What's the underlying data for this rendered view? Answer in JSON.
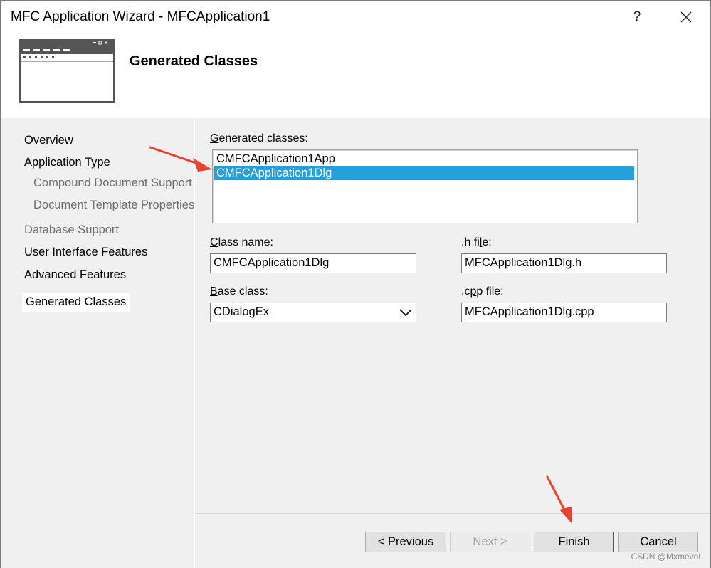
{
  "window": {
    "title": "MFC Application Wizard - MFCApplication1",
    "help_glyph": "?",
    "close_icon": "close-icon"
  },
  "header": {
    "title": "Generated Classes",
    "art_icon": "window-template-icon"
  },
  "nav": {
    "items": [
      {
        "label": "Overview",
        "state": "normal"
      },
      {
        "label": "Application Type",
        "state": "normal"
      },
      {
        "label": "Compound Document Support",
        "state": "disabled"
      },
      {
        "label": "Document Template Properties",
        "state": "disabled"
      },
      {
        "label": "Database Support",
        "state": "disabled"
      },
      {
        "label": "User Interface Features",
        "state": "normal"
      },
      {
        "label": "Advanced Features",
        "state": "normal"
      },
      {
        "label": "Generated Classes",
        "state": "selected"
      }
    ]
  },
  "main": {
    "generated_classes": {
      "label_accel": "G",
      "label_rest": "enerated classes:",
      "items": [
        "CMFCApplication1App",
        "CMFCApplication1Dlg"
      ],
      "selected_index": 1
    },
    "class_name": {
      "label_pre": "",
      "label_accel": "C",
      "label_rest": "lass name:",
      "value": "CMFCApplication1Dlg"
    },
    "h_file": {
      "label_pre": ".h fi",
      "label_accel": "l",
      "label_rest": "e:",
      "value": "MFCApplication1Dlg.h"
    },
    "base_class": {
      "label_pre": "",
      "label_accel": "B",
      "label_rest": "ase class:",
      "value": "CDialogEx"
    },
    "cpp_file": {
      "label_pre": ".c",
      "label_accel": "p",
      "label_rest": "p file:",
      "value": "MFCApplication1Dlg.cpp"
    }
  },
  "footer": {
    "previous_label": "< Previous",
    "next_label": "Next >",
    "finish_label": "Finish",
    "cancel_label": "Cancel"
  },
  "watermark": "CSDN @Mxmevol",
  "colors": {
    "selection": "#24a0da",
    "annotation_arrow": "#e8432e",
    "panel_bg": "#f0f0f0"
  }
}
